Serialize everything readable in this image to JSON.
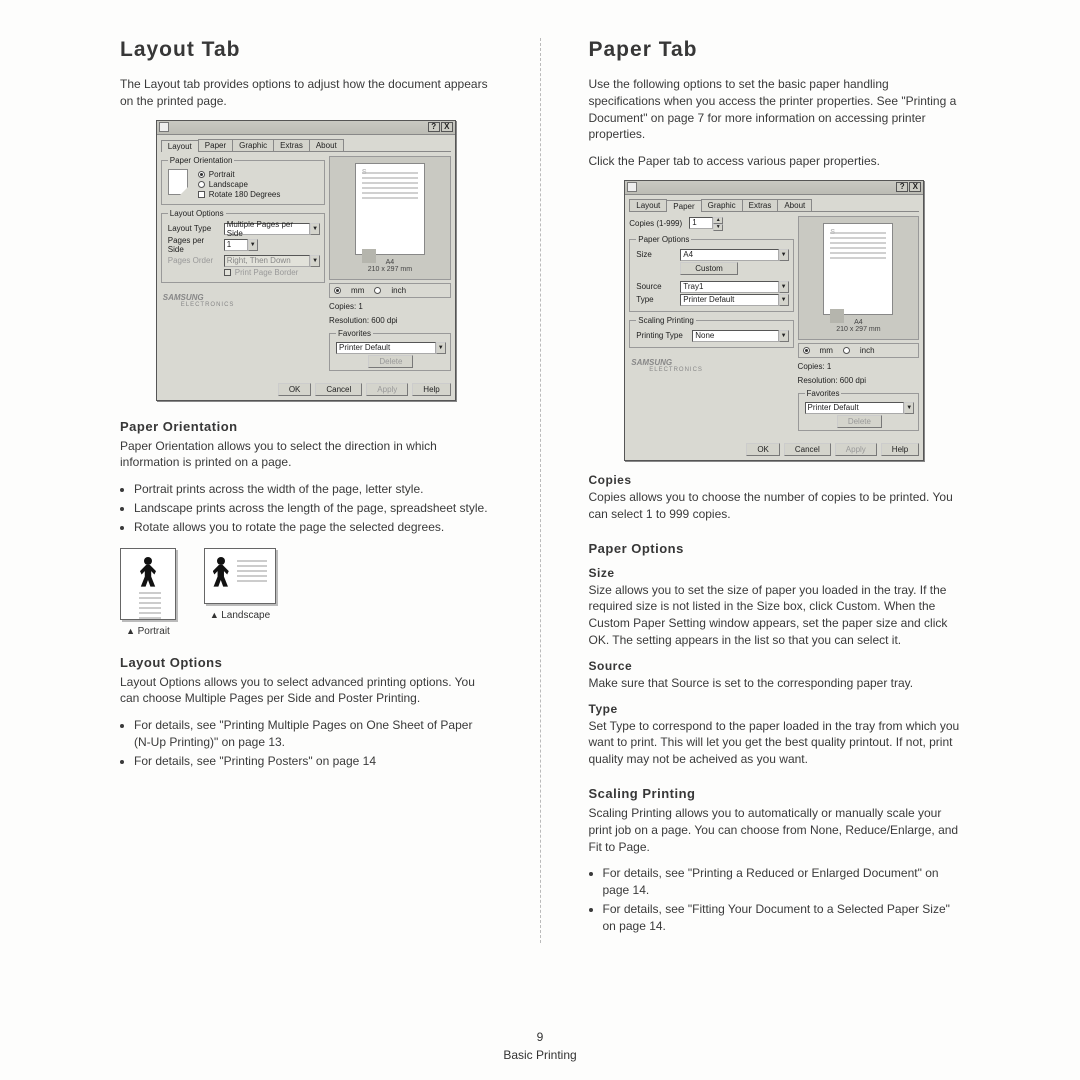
{
  "page": {
    "number": "9",
    "section": "Basic Printing"
  },
  "left": {
    "title": "Layout Tab",
    "intro": "The Layout tab provides options to adjust how the document appears on the printed page.",
    "dialog": {
      "help_btn": "?",
      "close_btn": "X",
      "tabs": [
        "Layout",
        "Paper",
        "Graphic",
        "Extras",
        "About"
      ],
      "active_tab": "Layout",
      "orientation": {
        "legend": "Paper Orientation",
        "portrait": "Portrait",
        "landscape": "Landscape",
        "rotate": "Rotate 180 Degrees"
      },
      "layout_opts": {
        "legend": "Layout Options",
        "layout_type_lbl": "Layout Type",
        "layout_type_val": "Multiple Pages per Side",
        "pages_side_lbl": "Pages per Side",
        "pages_side_val": "1",
        "order_lbl": "Pages Order",
        "order_val": "Right, Then Down",
        "border": "Print Page Border"
      },
      "preview": {
        "caption1": "A4",
        "caption2": "210 x 297 mm"
      },
      "units": {
        "mm": "mm",
        "inch": "inch"
      },
      "copies": "Copies: 1",
      "resolution": "Resolution: 600 dpi",
      "favorites": {
        "legend": "Favorites",
        "value": "Printer Default",
        "delete": "Delete"
      },
      "brand": "SAMSUNG",
      "brand_sub": "ELECTRONICS",
      "buttons": {
        "ok": "OK",
        "cancel": "Cancel",
        "apply": "Apply",
        "help": "Help"
      }
    },
    "po": {
      "head": "Paper Orientation",
      "body": "Paper Orientation allows you to select the direction in which information is printed on a page.",
      "b1": "Portrait prints across the width of the page, letter style.",
      "b2": "Landscape prints across the length of the page, spreadsheet style.",
      "b3": "Rotate allows you to rotate the page the selected degrees.",
      "cap_p": "Portrait",
      "cap_l": "Landscape"
    },
    "lo": {
      "head": "Layout Options",
      "body": "Layout Options allows you to select advanced printing options. You can choose Multiple Pages per Side and Poster Printing.",
      "b1": "For details, see \"Printing Multiple Pages on One Sheet of Paper (N-Up Printing)\" on page 13.",
      "b2": "For details, see \"Printing Posters\" on page 14"
    }
  },
  "right": {
    "title": "Paper Tab",
    "intro1": "Use the following options to set the basic paper handling specifications when you access the printer properties. See \"Printing a Document\" on page 7 for more information on accessing printer properties.",
    "intro2": "Click the Paper tab to access various paper properties.",
    "dialog": {
      "tabs": [
        "Layout",
        "Paper",
        "Graphic",
        "Extras",
        "About"
      ],
      "active_tab": "Paper",
      "copies_lbl": "Copies (1-999)",
      "copies_val": "1",
      "paper_opts": {
        "legend": "Paper Options",
        "size_lbl": "Size",
        "size_val": "A4",
        "custom_btn": "Custom",
        "source_lbl": "Source",
        "source_val": "Tray1",
        "type_lbl": "Type",
        "type_val": "Printer Default"
      },
      "scaling": {
        "legend": "Scaling Printing",
        "type_lbl": "Printing Type",
        "type_val": "None"
      },
      "preview": {
        "caption1": "A4",
        "caption2": "210 x 297 mm"
      },
      "units": {
        "mm": "mm",
        "inch": "inch"
      },
      "copies_line": "Copies: 1",
      "resolution": "Resolution: 600 dpi",
      "favorites": {
        "legend": "Favorites",
        "value": "Printer Default",
        "delete": "Delete"
      },
      "buttons": {
        "ok": "OK",
        "cancel": "Cancel",
        "apply": "Apply",
        "help": "Help"
      }
    },
    "copies": {
      "head": "Copies",
      "body": "Copies allows you to choose the number of copies to be printed. You can select 1 to 999 copies."
    },
    "paper_options_head": "Paper Options",
    "size": {
      "head": "Size",
      "body": "Size allows you to set the size of paper you loaded in the tray. If the required size is not listed in the Size box, click Custom. When the Custom Paper Setting window appears, set the paper size and click OK. The setting appears in the list so that you can select it."
    },
    "source": {
      "head": "Source",
      "body": "Make sure that Source is set to the corresponding paper tray."
    },
    "type": {
      "head": "Type",
      "body": "Set Type to correspond to the paper loaded in the tray from which you want to print. This will let you get the best quality printout. If not, print quality may not be acheived as you want."
    },
    "scaling": {
      "head": "Scaling Printing",
      "body": "Scaling Printing allows you to automatically or manually scale your print job on a page. You can choose from None, Reduce/Enlarge, and Fit to Page.",
      "b1": "For details, see \"Printing a Reduced or Enlarged Document\" on page 14.",
      "b2": "For details, see \"Fitting Your Document to a Selected Paper Size\" on page 14."
    }
  }
}
